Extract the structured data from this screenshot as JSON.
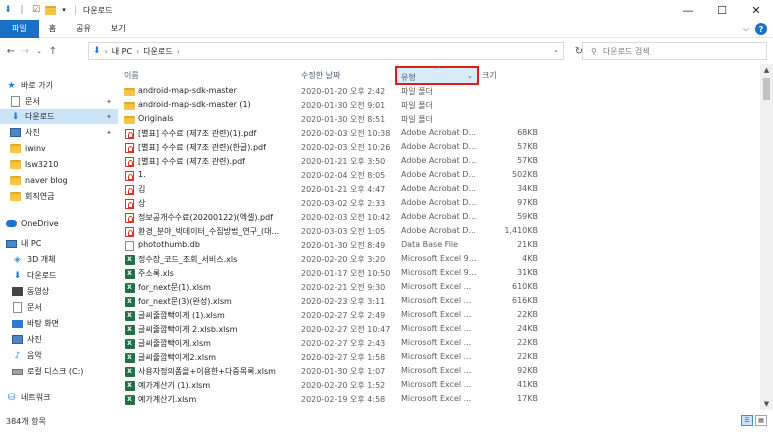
{
  "titlebar": {
    "title": "다운로드",
    "minimize": "—",
    "maximize": "☐",
    "close": "✕"
  },
  "ribbon": {
    "tabs": [
      "파일",
      "홈",
      "공유",
      "보기"
    ],
    "help": "?"
  },
  "nav": {
    "breadcrumb": [
      "내 PC",
      "다운로드"
    ],
    "search_placeholder": "다운로드 검색"
  },
  "sidebar": {
    "items": [
      {
        "label": "바로 가기",
        "icon": "star-icon",
        "pinned": false
      },
      {
        "label": "문서",
        "icon": "document-icon",
        "pinned": true
      },
      {
        "label": "다운로드",
        "icon": "download-icon",
        "pinned": true,
        "selected": true
      },
      {
        "label": "사진",
        "icon": "picture-icon",
        "pinned": true
      },
      {
        "label": "iwinv",
        "icon": "folder-icon",
        "pinned": false
      },
      {
        "label": "lsw3210",
        "icon": "folder-icon",
        "pinned": false
      },
      {
        "label": "naver blog",
        "icon": "folder-icon",
        "pinned": false
      },
      {
        "label": "회직연금",
        "icon": "folder-icon",
        "pinned": false
      },
      {
        "label": "OneDrive",
        "icon": "cloud-icon",
        "pinned": false
      },
      {
        "label": "내 PC",
        "icon": "pc-icon",
        "pinned": false
      },
      {
        "label": "3D 개체",
        "icon": "cube-icon",
        "pinned": false
      },
      {
        "label": "다운로드",
        "icon": "download-icon",
        "pinned": false
      },
      {
        "label": "동영상",
        "icon": "video-icon",
        "pinned": false
      },
      {
        "label": "문서",
        "icon": "document-icon",
        "pinned": false
      },
      {
        "label": "바탕 화면",
        "icon": "desktop-icon",
        "pinned": false
      },
      {
        "label": "사진",
        "icon": "picture-icon",
        "pinned": false
      },
      {
        "label": "음악",
        "icon": "music-icon",
        "pinned": false
      },
      {
        "label": "로컬 디스크 (C:)",
        "icon": "drive-icon",
        "pinned": false
      },
      {
        "label": "네트워크",
        "icon": "network-icon",
        "pinned": false
      }
    ]
  },
  "columns": {
    "name": "이름",
    "date": "수정한 날짜",
    "type": "유형",
    "size": "크기"
  },
  "files": [
    {
      "name": "android-map-sdk-master",
      "date": "2020-01-20 오후 2:42",
      "type": "파일 폴더",
      "size": "",
      "icon": "folder"
    },
    {
      "name": "android-map-sdk-master (1)",
      "date": "2020-01-30 오전 9:01",
      "type": "파일 폴더",
      "size": "",
      "icon": "folder"
    },
    {
      "name": "Originals",
      "date": "2020-01-30 오전 8:51",
      "type": "파일 폴더",
      "size": "",
      "icon": "folder"
    },
    {
      "name": "[별표] 수수료 (제7조 관련)(1).pdf",
      "date": "2020-02-03 오전 10:38",
      "type": "Adobe Acrobat D...",
      "size": "68KB",
      "icon": "pdf"
    },
    {
      "name": "[별표] 수수료 (제7조 관련)(한글).pdf",
      "date": "2020-02-03 오전 10:26",
      "type": "Adobe Acrobat D...",
      "size": "57KB",
      "icon": "pdf"
    },
    {
      "name": "[별표] 수수료 (제7조 관련).pdf",
      "date": "2020-01-21 오후 3:50",
      "type": "Adobe Acrobat D...",
      "size": "57KB",
      "icon": "pdf"
    },
    {
      "name": "1.",
      "date": "2020-02-04 오전 8:05",
      "type": "Adobe Acrobat D...",
      "size": "502KB",
      "icon": "pdf"
    },
    {
      "name": "김",
      "date": "2020-01-21 오후 4:47",
      "type": "Adobe Acrobat D...",
      "size": "34KB",
      "icon": "pdf"
    },
    {
      "name": "상",
      "date": "2020-03-02 오후 2:33",
      "type": "Adobe Acrobat D...",
      "size": "97KB",
      "icon": "pdf"
    },
    {
      "name": "정보공개수수료(20200122)(엑셀).pdf",
      "date": "2020-02-03 오전 10:42",
      "type": "Adobe Acrobat D...",
      "size": "59KB",
      "icon": "pdf"
    },
    {
      "name": "환경_분야_빅데이터_수집방법_연구_(대...",
      "date": "2020-03-03 오전 1:05",
      "type": "Adobe Acrobat D...",
      "size": "1,410KB",
      "icon": "pdf"
    },
    {
      "name": "photothumb.db",
      "date": "2020-01-30 오전 8:49",
      "type": "Data Base File",
      "size": "21KB",
      "icon": "db"
    },
    {
      "name": "정수장_코드_조회_서비스.xls",
      "date": "2020-02-20 오후 3:20",
      "type": "Microsoft Excel 9...",
      "size": "4KB",
      "icon": "xls"
    },
    {
      "name": "주소록.xls",
      "date": "2020-01-17 오전 10:50",
      "type": "Microsoft Excel 9...",
      "size": "31KB",
      "icon": "xls"
    },
    {
      "name": "for_next문(1).xlsm",
      "date": "2020-02-21 오전 9:30",
      "type": "Microsoft Excel ...",
      "size": "610KB",
      "icon": "xls"
    },
    {
      "name": "for_next문(3)(완성).xlsm",
      "date": "2020-02-23 오후 3:11",
      "type": "Microsoft Excel ...",
      "size": "616KB",
      "icon": "xls"
    },
    {
      "name": "글씨줄깜빡이게 (1).xlsm",
      "date": "2020-02-27 오후 2:49",
      "type": "Microsoft Excel ...",
      "size": "22KB",
      "icon": "xls"
    },
    {
      "name": "글씨줄깜빡이게 2.xlsb.xlsm",
      "date": "2020-02-27 오전 10:47",
      "type": "Microsoft Excel ...",
      "size": "24KB",
      "icon": "xls"
    },
    {
      "name": "글씨줄깜빡이게.xlsm",
      "date": "2020-02-27 오후 2:43",
      "type": "Microsoft Excel ...",
      "size": "22KB",
      "icon": "xls"
    },
    {
      "name": "글씨줄깜빡이게2.xlsm",
      "date": "2020-02-27 오후 1:58",
      "type": "Microsoft Excel ...",
      "size": "22KB",
      "icon": "xls"
    },
    {
      "name": "사용자정의폼을+이용한+다중목록.xlsm",
      "date": "2020-01-30 오후 1:07",
      "type": "Microsoft Excel ...",
      "size": "92KB",
      "icon": "xls"
    },
    {
      "name": "예가계산기 (1).xlsm",
      "date": "2020-02-20 오후 1:52",
      "type": "Microsoft Excel ...",
      "size": "41KB",
      "icon": "xls"
    },
    {
      "name": "예가계산기.xlsm",
      "date": "2020-02-19 오후 4:58",
      "type": "Microsoft Excel ...",
      "size": "17KB",
      "icon": "xls"
    }
  ],
  "status": {
    "item_count": "384개 항목"
  },
  "colors": {
    "accent": "#1a6fc7",
    "highlight_box": "#e01b1b",
    "selected_bg": "#cce4f7"
  }
}
